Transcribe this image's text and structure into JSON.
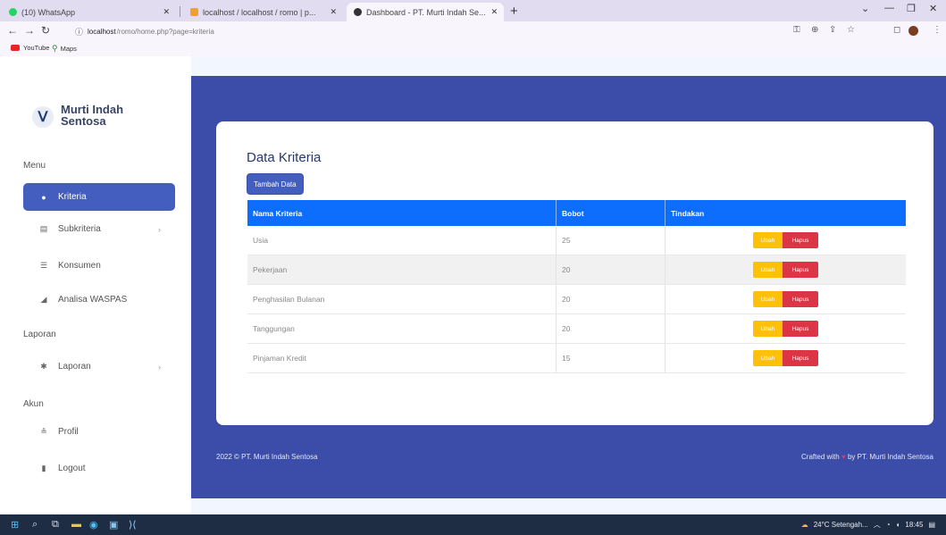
{
  "browser": {
    "tabs": [
      {
        "title": "(10) WhatsApp",
        "active": false
      },
      {
        "title": "localhost / localhost / romo | p...",
        "active": false
      },
      {
        "title": "Dashboard - PT. Murti Indah Se...",
        "active": true
      }
    ],
    "address_host": "localhost",
    "address_path": "/romo/home.php?page=kriteria",
    "bookmarks": [
      "YouTube",
      "Maps"
    ]
  },
  "sidebar": {
    "logo_line1": "Murti Indah",
    "logo_line2": "Sentosa",
    "sections": {
      "menu": "Menu",
      "laporan": "Laporan",
      "akun": "Akun"
    },
    "items": [
      {
        "label": "Kriteria",
        "icon": "circle-icon",
        "active": true
      },
      {
        "label": "Subkriteria",
        "icon": "stack-icon",
        "active": false
      },
      {
        "label": "Konsumen",
        "icon": "users-icon",
        "active": false
      },
      {
        "label": "Analisa WASPAS",
        "icon": "chart-icon",
        "active": false
      },
      {
        "label": "Laporan",
        "icon": "report-icon",
        "active": false
      },
      {
        "label": "Profil",
        "icon": "user-icon",
        "active": false
      },
      {
        "label": "Logout",
        "icon": "logout-icon",
        "active": false
      }
    ]
  },
  "main": {
    "title": "Data Kriteria",
    "add_button": "Tambah Data",
    "table": {
      "headers": [
        "Nama Kriteria",
        "Bobot",
        "Tindakan"
      ],
      "rows": [
        {
          "nama": "Usia",
          "bobot": "25"
        },
        {
          "nama": "Pekerjaan",
          "bobot": "20"
        },
        {
          "nama": "Penghasilan Bulanan",
          "bobot": "20"
        },
        {
          "nama": "Tanggungan",
          "bobot": "20"
        },
        {
          "nama": "Pinjaman Kredit",
          "bobot": "15"
        }
      ],
      "edit_label": "Ubah",
      "delete_label": "Hapus"
    }
  },
  "footer": {
    "left": "2022 © PT. Murti Indah Sentosa",
    "right_prefix": "Crafted with",
    "right_suffix": "by PT. Murti Indah Sentosa"
  },
  "taskbar": {
    "weather": "24°C Setengah...",
    "time": "18:45"
  },
  "colors": {
    "primary": "#435ebe",
    "header": "#0d6efd",
    "band": "#3b4da8",
    "warning": "#ffc107",
    "danger": "#dc3545"
  }
}
